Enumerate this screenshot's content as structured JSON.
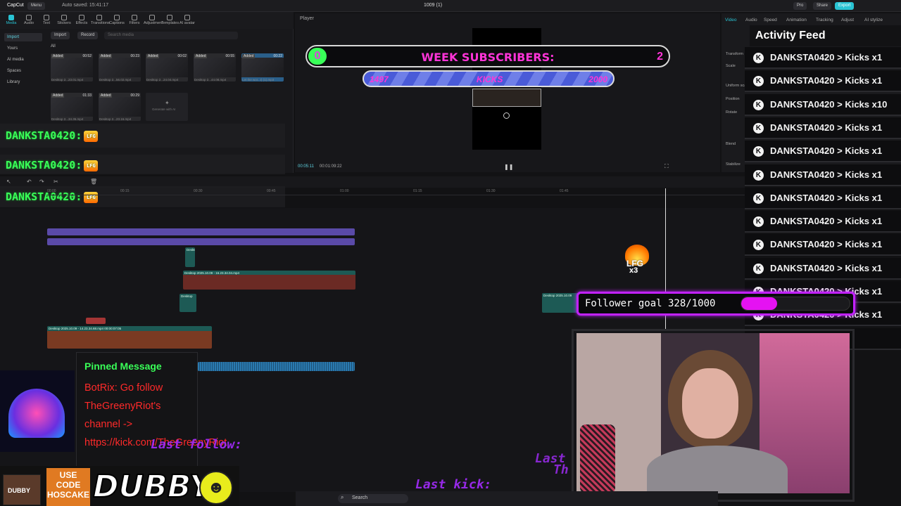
{
  "window": {
    "app": "CapCut",
    "menu": "Menu",
    "autosave": "Auto saved: 15:41:17",
    "project_title": "1009 (1)",
    "pills": [
      "Pro",
      "Share",
      "Export"
    ]
  },
  "tools": [
    {
      "label": "Media",
      "active": true
    },
    {
      "label": "Audio"
    },
    {
      "label": "Text"
    },
    {
      "label": "Stickers"
    },
    {
      "label": "Effects"
    },
    {
      "label": "Transitions"
    },
    {
      "label": "Captions"
    },
    {
      "label": "Filters"
    },
    {
      "label": "Adjustment"
    },
    {
      "label": "Templates"
    },
    {
      "label": "AI avatar"
    }
  ],
  "media": {
    "sidebar": [
      "Import",
      "Yours",
      "AI media",
      "Spaces",
      "Library"
    ],
    "import_label": "Import",
    "record_label": "Record",
    "search_placeholder": "Search media",
    "filter_label": "All",
    "thumbs": [
      {
        "badge": "Added",
        "dur": "00:52",
        "cap": "Desktop 2...23.01.mp4"
      },
      {
        "badge": "Added",
        "dur": "00:23",
        "cap": "Desktop 2...56.02.mp4"
      },
      {
        "badge": "Added",
        "dur": "00:02",
        "cap": "Desktop 2...24.04.mp4"
      },
      {
        "badge": "Added",
        "dur": "00:55",
        "cap": "Desktop 2...44.08.mp4"
      },
      {
        "badge": "Added",
        "dur": "00:22",
        "cap": "Let the wor...t) (1).mp3"
      },
      {
        "badge": "Added",
        "dur": "01:33",
        "cap": "Desktop 2...34.36.mp4"
      },
      {
        "badge": "Added",
        "dur": "00:29",
        "cap": "Desktop 2...23.16.mp4"
      }
    ],
    "generate_label": "Generate with AI"
  },
  "overlay_name": "DANKSTA0420:",
  "overlay_fire": "LFG",
  "player": {
    "title": "Player",
    "current_time": "00:05:11",
    "total_time": "00:01:09:22"
  },
  "sub_goal": {
    "current": "0",
    "label": "WEEK SUBSCRIBERS:",
    "goal": "2"
  },
  "kick_goal": {
    "left": "1497",
    "label": "KICKS",
    "right": "2000",
    "progress": 0.72
  },
  "inspector": {
    "tabs": [
      "Video",
      "Audio",
      "Speed",
      "Animation",
      "Tracking",
      "Adjust",
      "AI stylize"
    ],
    "labels": [
      "Transform",
      "Scale",
      "Uniform scale",
      "Position",
      "Rotate",
      "Blend",
      "Stabilize"
    ]
  },
  "activity_feed": {
    "title": "Activity Feed",
    "items": [
      "DANKSTA0420 > Kicks x1",
      "DANKSTA0420 > Kicks x1",
      "DANKSTA0420 > Kicks x10",
      "DANKSTA0420 > Kicks x1",
      "DANKSTA0420 > Kicks x1",
      "DANKSTA0420 > Kicks x1",
      "DANKSTA0420 > Kicks x1",
      "DANKSTA0420 > Kicks x1",
      "DANKSTA0420 > Kicks x1",
      "DANKSTA0420 > Kicks x1",
      "DANKSTA0420 > Kicks x1",
      "DANKSTA0420 > Kicks x1",
      "Kicks x1"
    ]
  },
  "timeline": {
    "ticks": [
      "00:00",
      "00:15",
      "00:30",
      "00:45",
      "01:00",
      "01:15",
      "01:30",
      "01:45"
    ],
    "clips": [
      "Desktop",
      "Desktop 2025.10.09 - 16.23.34.04.mp4",
      "Desktop 2025",
      "Desktop 2025",
      "Desktop 2025",
      "Desktop",
      "Desktop",
      "Desktop 2025.10.09 - 14.23.34.68.mp4  00:00:07:05",
      "Desktop 2025.10.09"
    ],
    "flame_label": "LFG",
    "flame_mult": "x3"
  },
  "follower_goal": {
    "label": "Follower goal 328/1000",
    "current": 328,
    "goal": 1000
  },
  "pinned": {
    "title": "Pinned Message",
    "body": "BotRix: Go follow TheGreenyRiot's channel -> https://kick.com/TheGreenyRiot"
  },
  "promo": {
    "use_code": "USE CODE",
    "code": "HOSCAKE",
    "brand": "DUBBY"
  },
  "ghost_text": {
    "last_follow": "Last follow:",
    "last_kick": "Last kick:",
    "last_short": "Last",
    "the": "Th"
  },
  "taskbar": {
    "search": "Search"
  },
  "colors": {
    "accent": "#29c3d3",
    "overlay_green": "#39ff58",
    "overlay_pink": "#ff34d8",
    "goal_purple": "#c222ff"
  }
}
